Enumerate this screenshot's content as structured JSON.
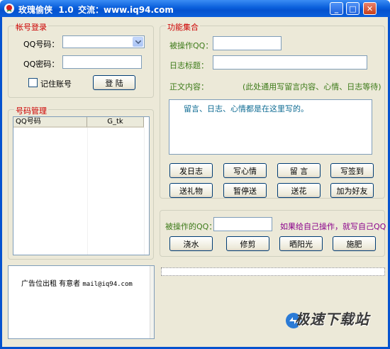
{
  "window": {
    "title": "玫瑰偷侠  1.0",
    "contact": "交流：www.iq94.com",
    "min_symbol": "_",
    "max_symbol": "□",
    "close_symbol": "✕"
  },
  "login_group": {
    "title": "帐号登录",
    "qq_label": "QQ号码：",
    "qq_value": "",
    "password_label": "QQ密码：",
    "password_value": "",
    "remember_label": "记住账号",
    "remember_checked": false,
    "login_button": "登  陆"
  },
  "account_group": {
    "title": "号码管理",
    "columns": [
      "QQ号码",
      "G_tk"
    ],
    "rows": []
  },
  "function_group": {
    "title": "功能集合",
    "target_qq_label": "被操作QQ：",
    "target_qq_value": "",
    "diary_title_label": "日志标题：",
    "diary_title_value": "",
    "content_label": "正文内容：",
    "content_hint": "(此处通用写留言内容、心情、日志等待)",
    "content_value": "留言、日志、心情都是在这里写的。",
    "buttons_row1": [
      "发日志",
      "写心情",
      "留 言",
      "写签到"
    ],
    "buttons_row2": [
      "送礼物",
      "暂停送",
      "送花",
      "加为好友"
    ]
  },
  "farm_group": {
    "target_label": "被操作的QQ：",
    "target_value": "",
    "hint": "如果给自己操作，就写自己QQ",
    "buttons": [
      "浇水",
      "修剪",
      "晒阳光",
      "施肥"
    ]
  },
  "ad_panel": {
    "line_text": "广告位出租 有意者",
    "email": "mail@iq94.com"
  },
  "watermark": {
    "text": "极速下载站"
  },
  "colors": {
    "titlebar": "#0a5fdb",
    "window_bg": "#ece9d8",
    "group_title": "#cc0000",
    "memo_text": "#0e6b93",
    "farm_hint": "#8a008a"
  }
}
